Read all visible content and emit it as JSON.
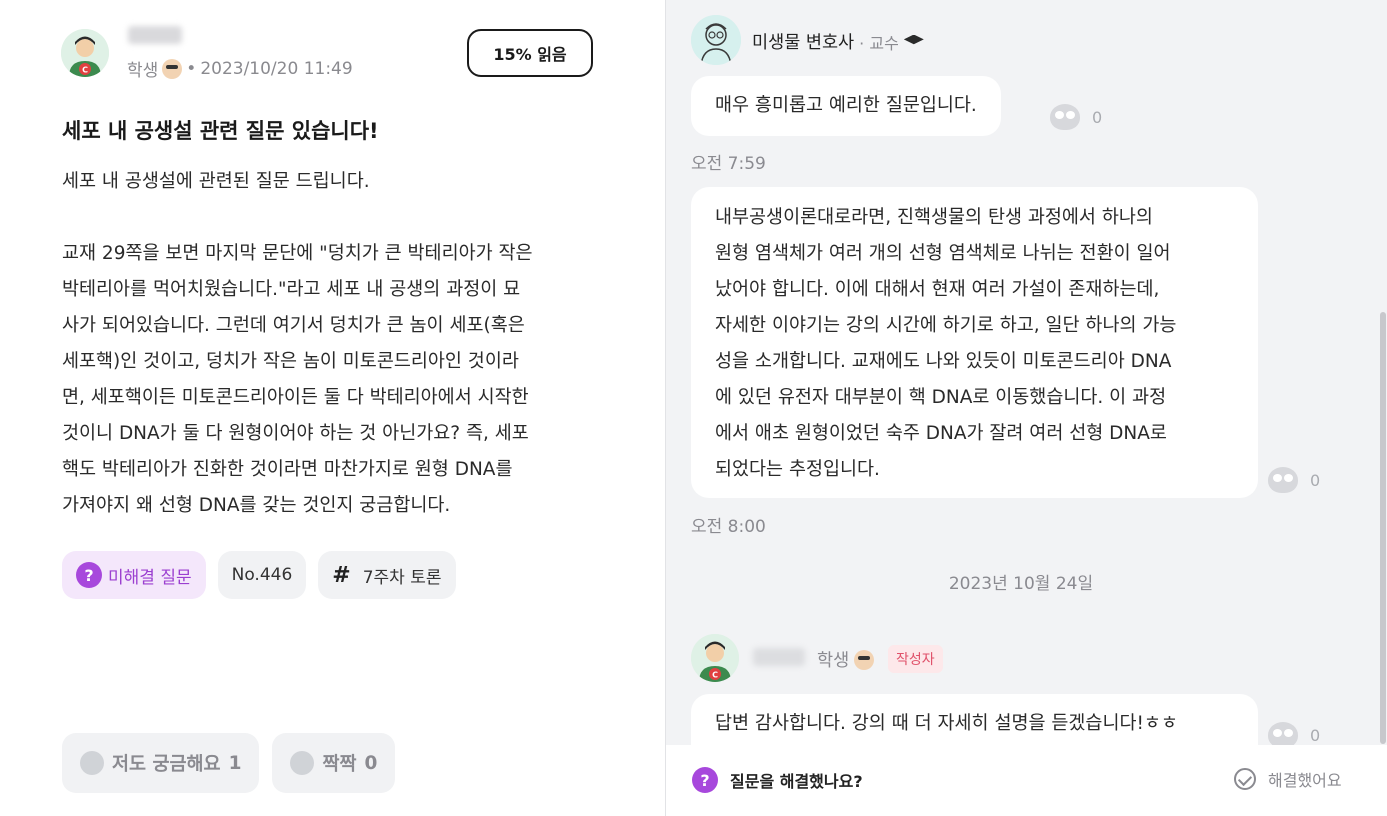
{
  "post": {
    "author_role": "학생",
    "timestamp": "2023/10/20 11:49",
    "read_progress": "15% 읽음",
    "title": "세포 내 공생설 관련 질문 있습니다!",
    "body_lines": [
      "세포 내 공생설에 관련된 질문 드립니다.",
      "",
      "교재 29쪽을 보면 마지막 문단에 \"덩치가 큰 박테리아가 작은",
      "박테리아를 먹어치웠습니다.\"라고 세포 내 공생의 과정이 묘",
      "사가 되어있습니다. 그런데 여기서 덩치가 큰 놈이 세포(혹은",
      "세포핵)인 것이고, 덩치가 작은 놈이 미토콘드리아인 것이라",
      "면, 세포핵이든 미토콘드리아이든 둘 다 박테리아에서 시작한",
      "것이니 DNA가 둘 다 원형이어야 하는 것 아닌가요? 즉, 세포",
      "핵도 박테리아가 진화한 것이라면 마찬가지로 원형 DNA를",
      "가져야지 왜 선형 DNA를 갖는 것인지 궁금합니다."
    ],
    "tags": {
      "status": "미해결 질문",
      "number": "No.446",
      "topic": "7주차 토론"
    },
    "reactions": {
      "curious_label": "저도 궁금해요",
      "curious_count": "1",
      "clap_label": "짝짝",
      "clap_count": "0"
    }
  },
  "thread": {
    "professor": {
      "name": "미생물 변호사",
      "role": "· 교수"
    },
    "messages": [
      {
        "lines": [
          "매우 흥미롭고 예리한 질문입니다."
        ],
        "likes": "0",
        "time": "오전 7:59"
      },
      {
        "lines": [
          "내부공생이론대로라면, 진핵생물의 탄생 과정에서 하나의",
          "원형 염색체가 여러 개의 선형 염색체로 나뉘는 전환이 일어",
          "났어야 합니다. 이에 대해서 현재 여러 가설이 존재하는데,",
          "자세한 이야기는 강의 시간에 하기로 하고, 일단 하나의 가능",
          "성을 소개합니다. 교재에도 나와 있듯이 미토콘드리아 DNA",
          "에 있던 유전자 대부분이 핵 DNA로 이동했습니다. 이 과정",
          "에서 애초 원형이었던 숙주 DNA가 잘려 여러 선형 DNA로",
          "되었다는 추정입니다."
        ],
        "likes": "0",
        "time": "오전 8:00"
      }
    ],
    "date_separator": "2023년 10월 24일",
    "student": {
      "role": "학생",
      "badge": "작성자",
      "message": "답변 감사합니다. 강의 때 더 자세히 설명을 듣겠습니다!ㅎㅎ",
      "likes": "0"
    },
    "footer": {
      "question": "질문을 해결했나요?",
      "resolve_label": "해결했어요"
    }
  }
}
